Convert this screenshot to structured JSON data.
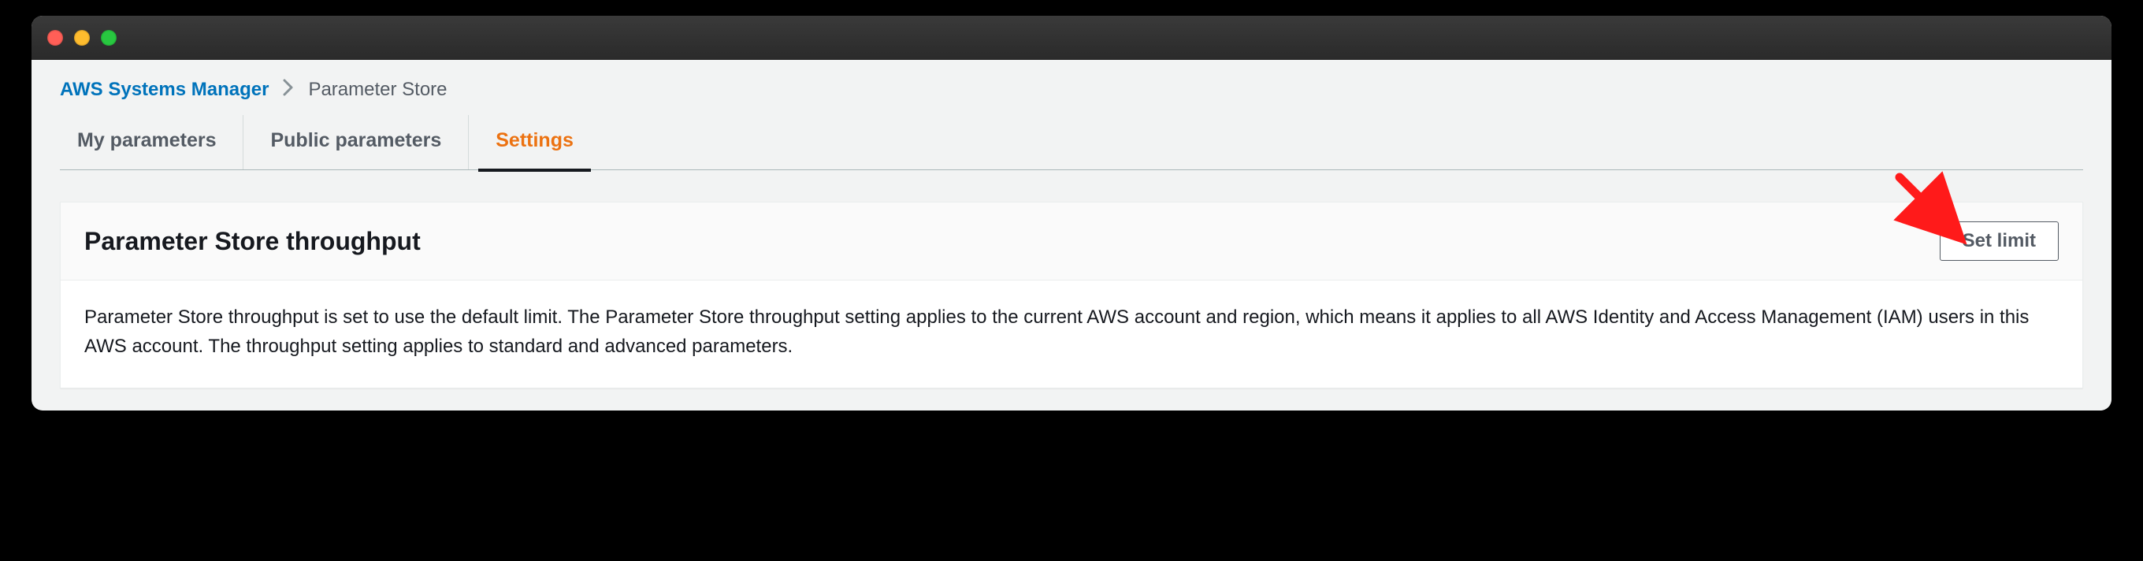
{
  "breadcrumb": {
    "link": "AWS Systems Manager",
    "current": "Parameter Store"
  },
  "tabs": [
    {
      "label": "My parameters",
      "active": false
    },
    {
      "label": "Public parameters",
      "active": false
    },
    {
      "label": "Settings",
      "active": true
    }
  ],
  "panel": {
    "title": "Parameter Store throughput",
    "button": "Set limit",
    "body": "Parameter Store throughput is set to use the default limit. The Parameter Store throughput setting applies to the current AWS account and region, which means it applies to all AWS Identity and Access Management (IAM) users in this AWS account. The throughput setting applies to standard and advanced parameters."
  }
}
